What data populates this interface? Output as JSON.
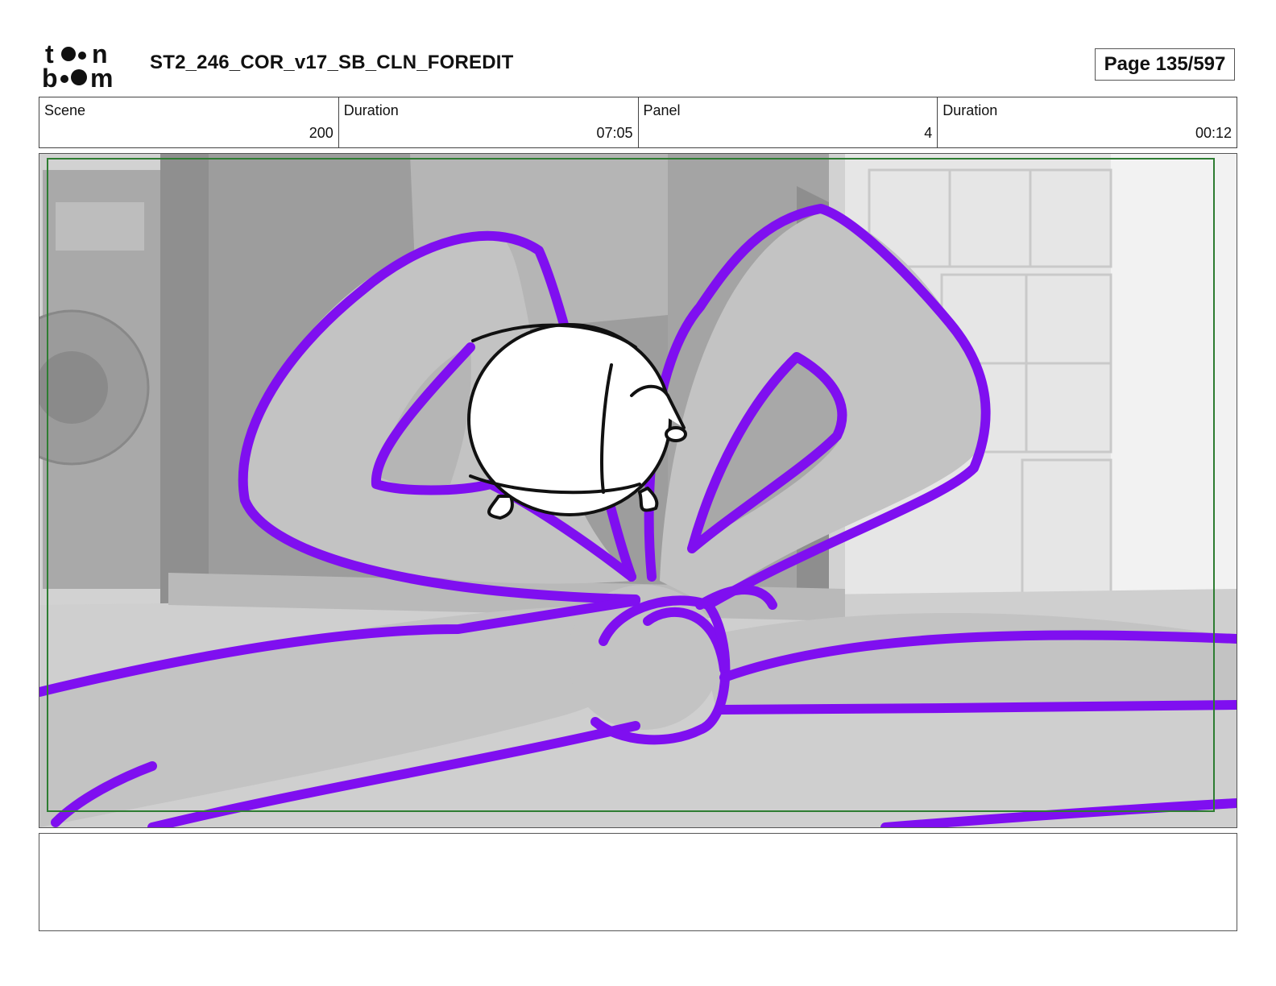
{
  "header": {
    "logo_text": "toon boom",
    "document_title": "ST2_246_COR_v17_SB_CLN_FOREDIT",
    "page_label": "Page 135/597"
  },
  "info": {
    "scene_label": "Scene",
    "scene_value": "200",
    "scene_duration_label": "Duration",
    "scene_duration_value": "07:05",
    "panel_label": "Panel",
    "panel_value": "4",
    "panel_duration_label": "Duration",
    "panel_duration_value": "00:12"
  },
  "panel": {
    "ribbon_color": "#7f0ff0",
    "safe_frame_color": "#2e7d32"
  },
  "notes": {
    "text": ""
  }
}
